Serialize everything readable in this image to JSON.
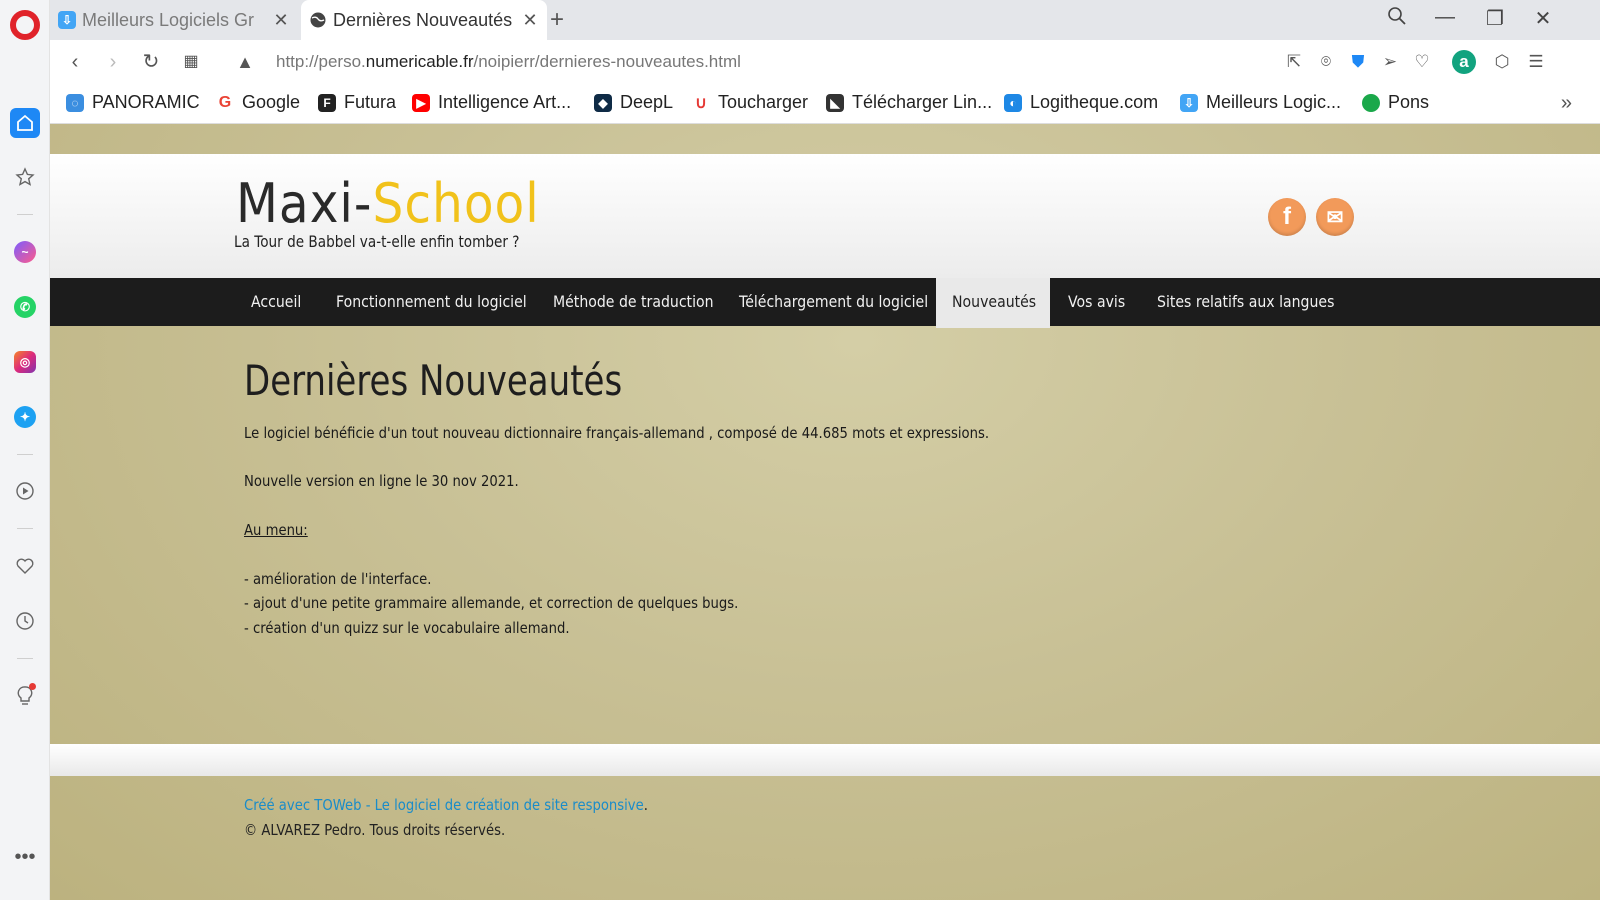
{
  "browser": {
    "tabs": [
      {
        "label": "Meilleurs Logiciels Gr",
        "icon": "download-site-icon"
      },
      {
        "label": "Dernières Nouveautés",
        "icon": "globe-icon"
      }
    ],
    "new_tab": "+",
    "url": {
      "prefix": "http://perso.",
      "host": "numericable.fr",
      "path": "/noipierr/dernieres-nouveautes.html"
    },
    "bookmarks": [
      {
        "label": "PANORAMIC",
        "icon": "chat-bubbles-icon",
        "color": "#3b8ee0"
      },
      {
        "label": "Google",
        "icon": "google-icon",
        "color": "#ea4335"
      },
      {
        "label": "Futura",
        "icon": "futura-icon",
        "color": "#222222"
      },
      {
        "label": "Intelligence Art...",
        "icon": "youtube-icon",
        "color": "#ff0000"
      },
      {
        "label": "DeepL",
        "icon": "deepl-icon",
        "color": "#0f2b46"
      },
      {
        "label": "Toucharger",
        "icon": "toucharger-icon",
        "color": "#e53935"
      },
      {
        "label": "Télécharger Lin...",
        "icon": "linux-icon",
        "color": "#333333"
      },
      {
        "label": "Logitheque.com",
        "icon": "logitheque-icon",
        "color": "#1e88e5"
      },
      {
        "label": "Meilleurs Logic...",
        "icon": "download-site-icon",
        "color": "#42a5f5"
      },
      {
        "label": "Pons",
        "icon": "pons-icon",
        "color": "#1aa84a"
      }
    ]
  },
  "site": {
    "logo_main": "Maxi-",
    "logo_accent": "School",
    "tagline": "La Tour de Babbel va-t-elle enfin tomber ?",
    "nav": [
      "Accueil",
      "Fonctionnement du logiciel",
      "Méthode de traduction",
      "Téléchargement du logiciel",
      "Nouveautés",
      "Vos avis",
      "Sites relatifs aux langues"
    ],
    "active_nav": "Nouveautés",
    "page_title": "Dernières Nouveautés",
    "paragraphs": [
      "Le logiciel bénéficie d'un tout nouveau dictionnaire français-allemand , composé de 44.685 mots et expressions.",
      "Nouvelle version en ligne le 30 nov 2021.",
      "Au menu:",
      "- amélioration de l'interface.",
      "- ajout d'une petite grammaire allemande, et correction de quelques bugs.",
      "- création d'un quizz sur le vocabulaire allemand."
    ],
    "footer_link": "Créé avec TOWeb - Le logiciel de création de site responsive",
    "footer_dot": ".",
    "footer_copy": "© ALVAREZ Pedro. Tous droits réservés.",
    "accent_color": "#f1c21b",
    "social_color": "#f29a5a",
    "background_color": "#c8c095"
  }
}
